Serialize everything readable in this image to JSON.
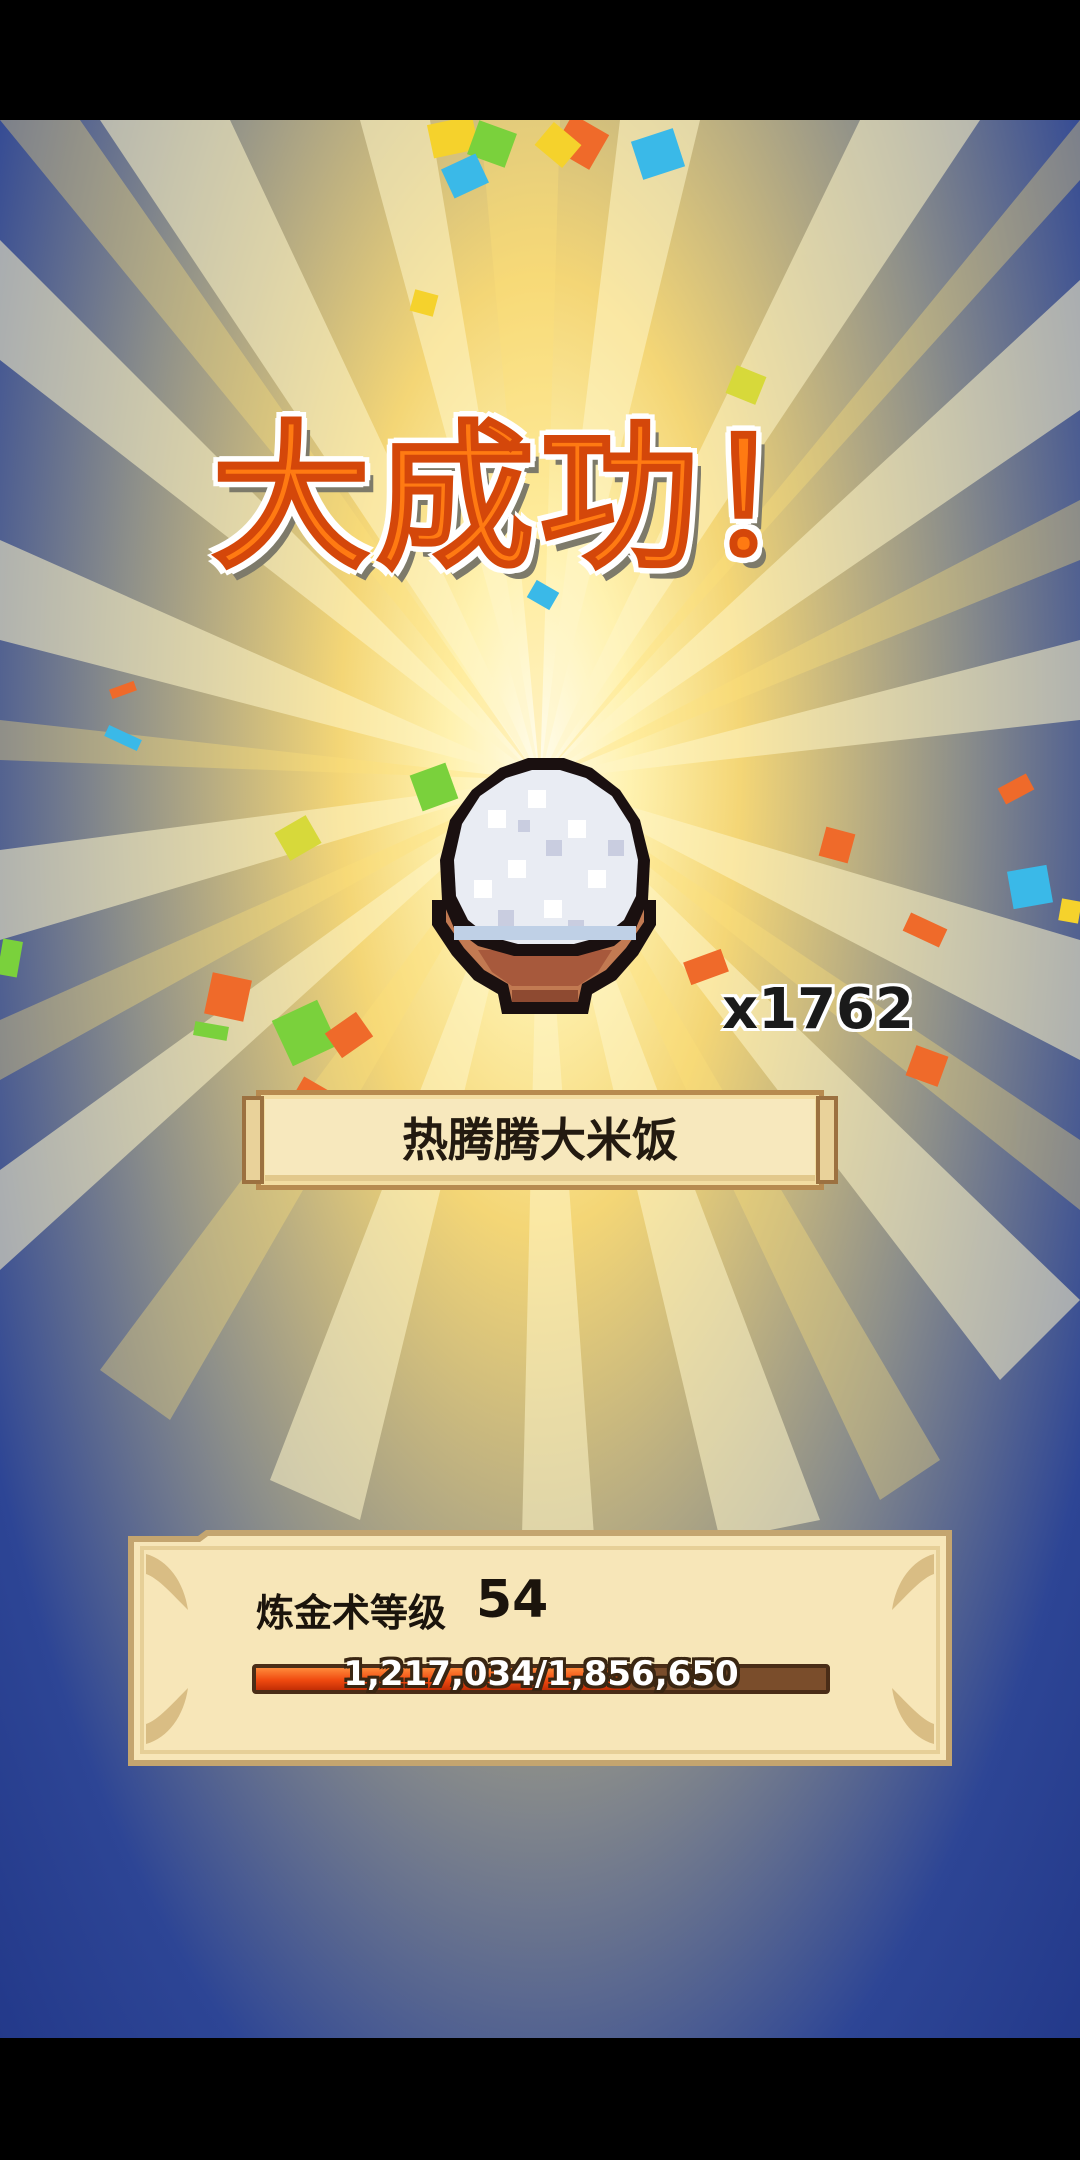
{
  "result": {
    "title": "大成功！",
    "item_name": "热腾腾大米饭",
    "item_icon": "rice-bowl-icon",
    "count": "x1762"
  },
  "level_panel": {
    "label": "炼金术等级",
    "level": "54",
    "xp_text": "1,217,034/1,856,650",
    "xp_current": 1217034,
    "xp_max": 1856650
  },
  "colors": {
    "title": "#ff7a12",
    "xp_fill": "#f04a10",
    "background_deep": "#0f1b55",
    "burst_center": "#fffbe8"
  }
}
